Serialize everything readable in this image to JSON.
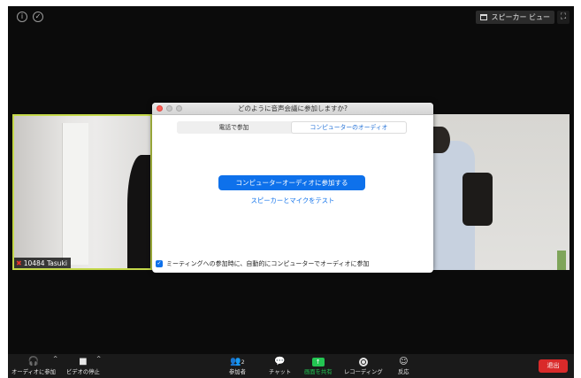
{
  "top_bar": {
    "info_icon_glyph": "i",
    "shield_icon_glyph": "✓",
    "view_label": "スピーカー ビュー",
    "fullscreen_glyph": "⛶"
  },
  "video": {
    "left_name": "10484 Tasuki",
    "muted_glyph": "✖"
  },
  "dialog": {
    "title": "どのように音声会議に参加しますか?",
    "tabs": [
      {
        "label": "電話で参加",
        "active": false
      },
      {
        "label": "コンピューターのオーディオ",
        "active": true
      }
    ],
    "join_button": "コンピューターオーディオに参加する",
    "test_link": "スピーカーとマイクをテスト",
    "auto_join_label": "ミーティングへの参加時に、自動的にコンピューターでオーディオに参加",
    "auto_join_checked": true,
    "checkmark": "✓"
  },
  "toolbar": {
    "audio": {
      "icon": "headphones-icon",
      "glyph": "🎧",
      "label": "オーディオに参加"
    },
    "video": {
      "icon": "camera-icon",
      "glyph": "■",
      "label": "ビデオの停止"
    },
    "caret": "^",
    "participants": {
      "icon": "people-icon",
      "glyph": "👥",
      "count": "2",
      "label": "参加者"
    },
    "chat": {
      "icon": "chat-icon",
      "glyph": "💬",
      "label": "チャット"
    },
    "share": {
      "icon": "share-screen-icon",
      "glyph": "↑",
      "label": "画面を共有"
    },
    "record": {
      "icon": "record-icon",
      "label": "レコーディング"
    },
    "reactions": {
      "icon": "reaction-icon",
      "glyph": "☺",
      "label": "反応"
    },
    "leave": "退出"
  },
  "colors": {
    "accent": "#0e71eb",
    "share_green": "#23c552",
    "leave_red": "#d92a2a",
    "active_speaker_border": "#c4d84a"
  }
}
